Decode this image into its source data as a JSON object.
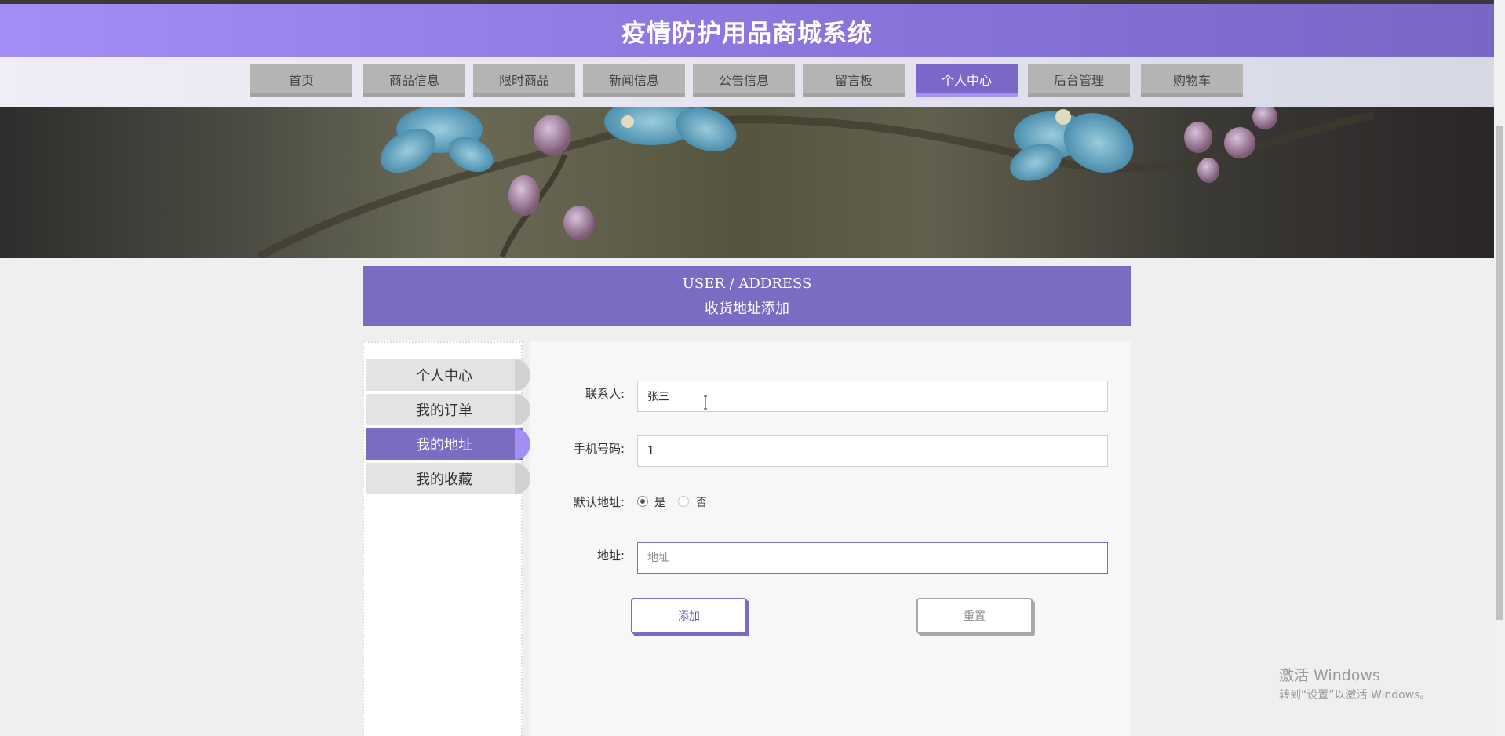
{
  "header": {
    "title": "疫情防护用品商城系统"
  },
  "nav": {
    "items": [
      {
        "label": "首页",
        "active": false
      },
      {
        "label": "商品信息",
        "active": false
      },
      {
        "label": "限时商品",
        "active": false
      },
      {
        "label": "新闻信息",
        "active": false
      },
      {
        "label": "公告信息",
        "active": false
      },
      {
        "label": "留言板",
        "active": false
      },
      {
        "label": "个人中心",
        "active": true
      },
      {
        "label": "后台管理",
        "active": false
      },
      {
        "label": "购物车",
        "active": false
      }
    ]
  },
  "section": {
    "title_en": "USER / ADDRESS",
    "title_cn": "收货地址添加"
  },
  "sidebar": {
    "items": [
      {
        "label": "个人中心",
        "active": false
      },
      {
        "label": "我的订单",
        "active": false
      },
      {
        "label": "我的地址",
        "active": true
      },
      {
        "label": "我的收藏",
        "active": false
      }
    ]
  },
  "form": {
    "contact": {
      "label": "联系人:",
      "value": "张三"
    },
    "phone": {
      "label": "手机号码:",
      "value": "1"
    },
    "default_address": {
      "label": "默认地址:",
      "options": [
        {
          "label": "是",
          "checked": true
        },
        {
          "label": "否",
          "checked": false
        }
      ]
    },
    "address": {
      "label": "地址:",
      "value": "",
      "placeholder": "地址"
    },
    "add_label": "添加",
    "reset_label": "重置"
  },
  "watermark": {
    "line1": "激活 Windows",
    "line2": "转到“设置”以激活 Windows。"
  },
  "colors": {
    "accent": "#7a6bc3",
    "accent_light": "#a38ef6",
    "nav_inactive": "#b4b4b4"
  }
}
